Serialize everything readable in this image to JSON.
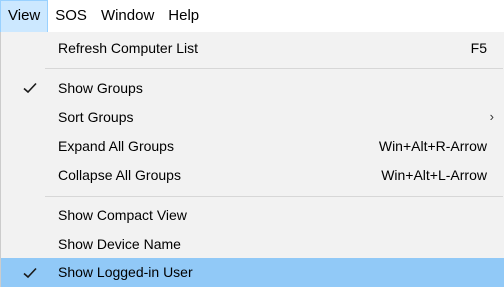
{
  "menubar": {
    "items": [
      {
        "label": "View",
        "active": true
      },
      {
        "label": "SOS",
        "active": false
      },
      {
        "label": "Window",
        "active": false
      },
      {
        "label": "Help",
        "active": false
      }
    ]
  },
  "view_menu": {
    "refresh": {
      "label": "Refresh Computer List",
      "shortcut": "F5"
    },
    "show_groups": {
      "label": "Show Groups",
      "checked": true
    },
    "sort_groups": {
      "label": "Sort Groups",
      "has_submenu": true,
      "arrow": "›"
    },
    "expand_all": {
      "label": "Expand All Groups",
      "shortcut": "Win+Alt+R-Arrow"
    },
    "collapse_all": {
      "label": "Collapse All Groups",
      "shortcut": "Win+Alt+L-Arrow"
    },
    "compact_view": {
      "label": "Show Compact View"
    },
    "device_name": {
      "label": "Show Device Name"
    },
    "logged_in_user": {
      "label": "Show Logged-in User",
      "checked": true,
      "highlighted": true
    }
  },
  "colors": {
    "menu_background": "#f2f2f2",
    "highlight": "#91c9f7",
    "active_menubar_item": "#cce8ff",
    "check_color": "#1a1a1a",
    "separator": "#d7d7d7"
  },
  "icons": {
    "check": "checkmark-icon",
    "submenu": "chevron-right-icon"
  }
}
